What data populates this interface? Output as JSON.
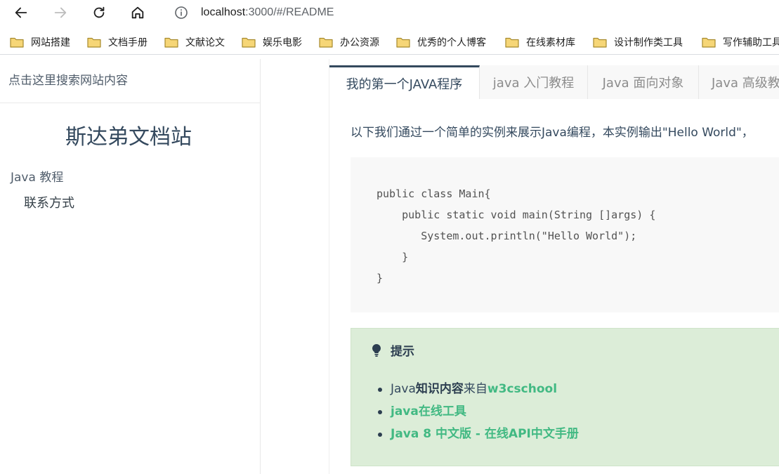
{
  "browser": {
    "url_host": "localhost",
    "url_path": ":3000/#/README",
    "icons": [
      "back-icon",
      "forward-icon",
      "reload-icon",
      "home-icon",
      "info-icon",
      "folder-icon"
    ],
    "bookmarks": [
      {
        "label": "网站搭建"
      },
      {
        "label": "文档手册"
      },
      {
        "label": "文献论文"
      },
      {
        "label": "娱乐电影"
      },
      {
        "label": "办公资源"
      },
      {
        "label": "优秀的个人博客"
      },
      {
        "label": "在线素材库"
      },
      {
        "label": "设计制作类工具"
      },
      {
        "label": "写作辅助工具"
      }
    ]
  },
  "sidebar": {
    "search_placeholder": "点击这里搜索网站内容",
    "app_name": "斯达弟文档站",
    "items": [
      {
        "label": "Java 教程"
      },
      {
        "label": "联系方式"
      }
    ]
  },
  "content": {
    "tabs": [
      {
        "label": "我的第一个JAVA程序",
        "active": true
      },
      {
        "label": "java 入门教程",
        "active": false
      },
      {
        "label": "Java 面向对象",
        "active": false
      },
      {
        "label": "Java 高级教程",
        "active": false
      }
    ],
    "intro": "以下我们通过一个简单的实例来展示Java编程，本实例输出\"Hello World\"，",
    "code": [
      "public class Main{",
      "    public static void main(String []args) {",
      "       System.out.println(\"Hello World\");",
      "    }",
      "}"
    ],
    "tip": {
      "title": "提示",
      "item1": {
        "part1": "Java",
        "part2": "知识内容",
        "part3": "来自",
        "link": "w3cschool"
      },
      "item2": {
        "link": "java在线工具"
      },
      "item3": {
        "link": "Java 8 中文版 - 在线API中文手册"
      }
    }
  },
  "colors": {
    "accent_link": "#42b983",
    "tip_background": "#dcedd8",
    "text": "#34495e"
  }
}
